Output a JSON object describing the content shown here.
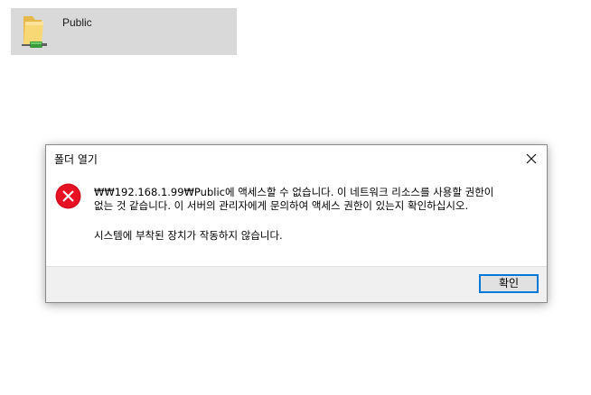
{
  "explorer": {
    "folder_label": "Public"
  },
  "dialog": {
    "title": "폴더 열기",
    "message_primary": "₩₩192.168.1.99₩Public에 액세스할 수 없습니다. 이 네트워크 리소스를 사용할 권한이 없는 것 같습니다. 이 서버의 관리자에게 문의하여 액세스 권한이 있는지 확인하십시오.",
    "message_secondary": "시스템에 부착된 장치가 작동하지 않습니다.",
    "ok_label": "확인",
    "icons": {
      "close": "close-icon",
      "error": "error-icon"
    }
  },
  "colors": {
    "accent": "#0078d7",
    "error_red": "#e81123",
    "tile_bg": "#d9d9d9",
    "footer_bg": "#f0f0f0"
  }
}
